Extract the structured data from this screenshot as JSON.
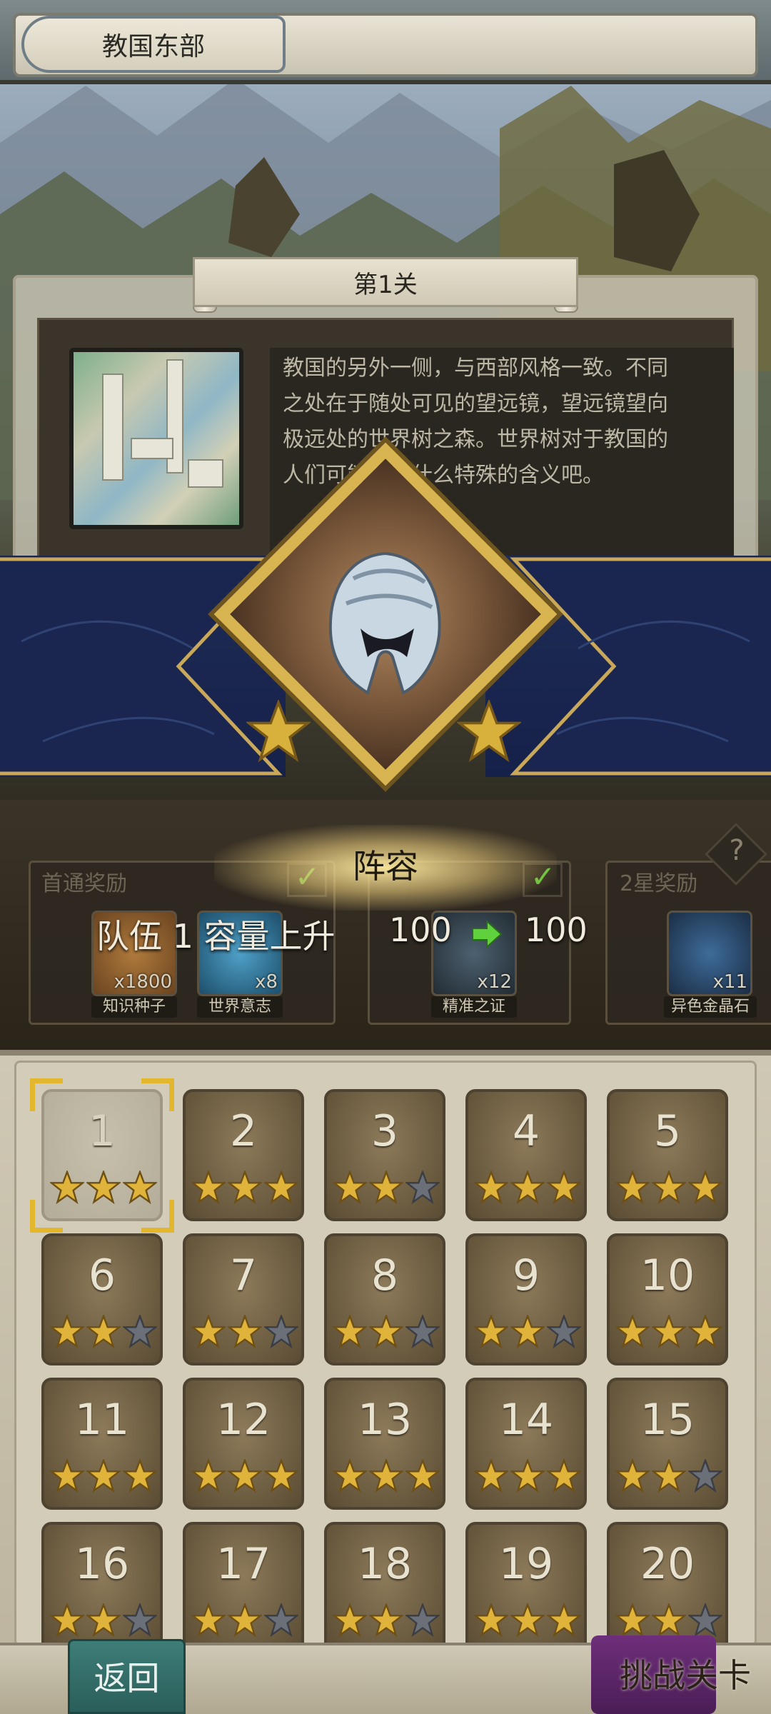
{
  "header": {
    "region_title": "教国东部"
  },
  "stage": {
    "title": "第1关",
    "description_lines": [
      "教国的另外一侧，与西部风格一致。不同",
      "之处在于随处可见的望远镜，望远镜望向",
      "极远处的世界树之森。世界树对于教国的",
      "人们可能有着什么特殊的含义吧。"
    ]
  },
  "popup": {
    "title": "阵容",
    "message": "队伍 1 容量上升",
    "old_value": "100",
    "new_value": "100",
    "icon": "knight-helmet-icon"
  },
  "rewards": {
    "first_clear_label": "首通奖励",
    "two_star_label": "2星奖励",
    "help_symbol": "?",
    "check_symbol": "✓",
    "items": [
      {
        "name": "知识种子",
        "count": "x1800",
        "icon": "seed-icon"
      },
      {
        "name": "世界意志",
        "count": "x8",
        "icon": "crystal-icon"
      },
      {
        "name": "精准之证",
        "count": "x12",
        "icon": "feather-icon"
      },
      {
        "name": "异色金晶石",
        "count": "x11",
        "icon": "gem-icon"
      }
    ]
  },
  "levels": [
    {
      "num": "1",
      "stars": 3,
      "current": true
    },
    {
      "num": "2",
      "stars": 3
    },
    {
      "num": "3",
      "stars": 2
    },
    {
      "num": "4",
      "stars": 3
    },
    {
      "num": "5",
      "stars": 3
    },
    {
      "num": "6",
      "stars": 2
    },
    {
      "num": "7",
      "stars": 2
    },
    {
      "num": "8",
      "stars": 2
    },
    {
      "num": "9",
      "stars": 2
    },
    {
      "num": "10",
      "stars": 3
    },
    {
      "num": "11",
      "stars": 3
    },
    {
      "num": "12",
      "stars": 3
    },
    {
      "num": "13",
      "stars": 3
    },
    {
      "num": "14",
      "stars": 3
    },
    {
      "num": "15",
      "stars": 2
    },
    {
      "num": "16",
      "stars": 2
    },
    {
      "num": "17",
      "stars": 2
    },
    {
      "num": "18",
      "stars": 2
    },
    {
      "num": "19",
      "stars": 3
    },
    {
      "num": "20",
      "stars": 2
    }
  ],
  "footer": {
    "back_label": "返回",
    "challenge_label": "挑战关卡"
  },
  "colors": {
    "star_gold": "#e0b33a",
    "star_grey": "#6b6f78",
    "accent_gold": "#d9b552",
    "banner_blue": "#1e2c55"
  }
}
